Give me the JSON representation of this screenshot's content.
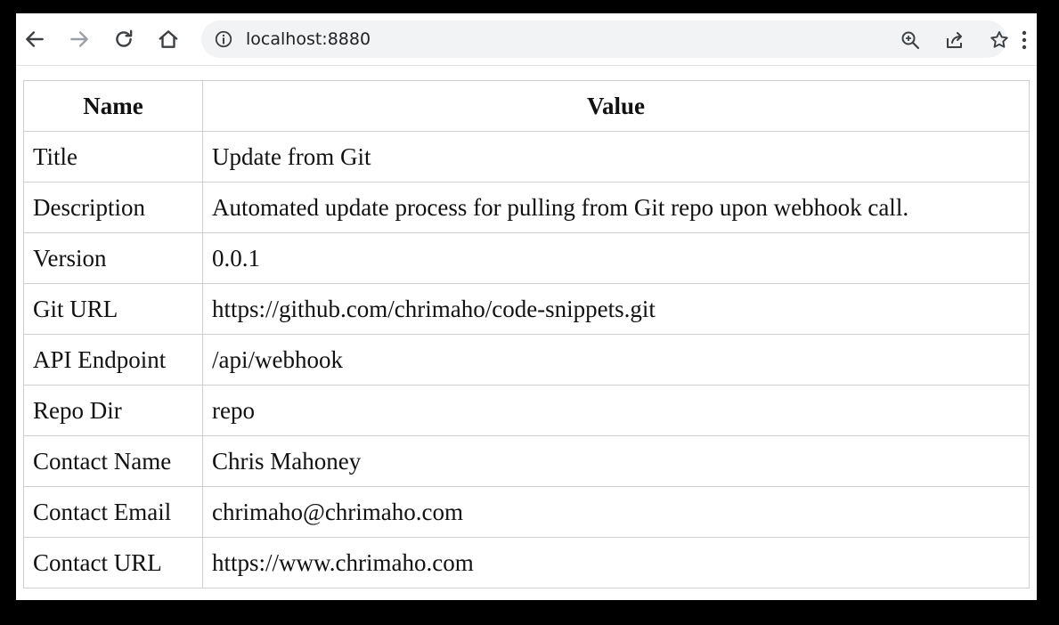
{
  "browser": {
    "url": "localhost:8880",
    "icons": {
      "back": "arrow-left-icon",
      "forward": "arrow-right-icon",
      "reload": "reload-icon",
      "home": "home-icon",
      "site_info": "info-icon",
      "zoom": "zoom-in-icon",
      "share": "share-icon",
      "bookmark": "star-icon",
      "menu": "kebab-menu-icon"
    }
  },
  "table": {
    "headers": [
      "Name",
      "Value"
    ],
    "rows": [
      {
        "name": "Title",
        "value": "Update from Git"
      },
      {
        "name": "Description",
        "value": "Automated update process for pulling from Git repo upon webhook call."
      },
      {
        "name": "Version",
        "value": "0.0.1"
      },
      {
        "name": "Git URL",
        "value": "https://github.com/chrimaho/code-snippets.git"
      },
      {
        "name": "API Endpoint",
        "value": "/api/webhook"
      },
      {
        "name": "Repo Dir",
        "value": "repo"
      },
      {
        "name": "Contact Name",
        "value": "Chris Mahoney"
      },
      {
        "name": "Contact Email",
        "value": "chrimaho@chrimaho.com"
      },
      {
        "name": "Contact URL",
        "value": "https://www.chrimaho.com"
      }
    ]
  },
  "colors": {
    "frame_background": "#000000",
    "omnibox_background": "#f1f3f4",
    "table_border": "#cfcfcf",
    "text": "#111111",
    "icon_enabled": "#3c4043",
    "icon_disabled": "#9aa0a6"
  }
}
